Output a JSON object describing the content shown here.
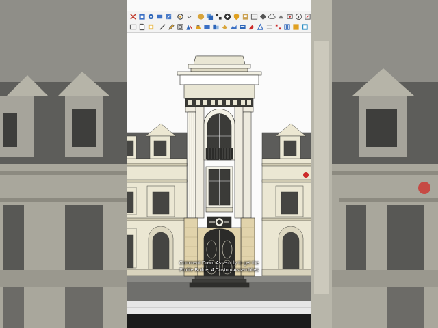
{
  "caption": {
    "line1": "Comment Down Assembly to get the",
    "line2": "Profile Builder 4 Custom Assemblies"
  },
  "toolbar": {
    "row1_icons": [
      "close-icon",
      "select-icon",
      "tape-icon",
      "component-icon",
      "paint-icon",
      "orbit-icon",
      "dropdown-icon",
      "solid-icon",
      "outliner-icon",
      "group-icon",
      "plus-icon",
      "shield-icon",
      "layers-icon",
      "scene-icon",
      "network-icon",
      "cloud-icon",
      "push-icon",
      "extension-icon",
      "info-icon",
      "dynamic-icon",
      "cart-icon",
      "power-icon"
    ],
    "row2_icons": [
      "rectangle-icon",
      "page-icon",
      "layout-icon",
      "line-icon",
      "pencil-icon",
      "offset-icon",
      "move-icon",
      "stamp-icon",
      "follow-icon",
      "section-icon",
      "rotate-icon",
      "sandbox-icon",
      "scale-icon",
      "eraser-icon",
      "flip-icon",
      "align-icon",
      "array-icon",
      "profile-icon",
      "assembly-icon",
      "material-icon",
      "render-icon"
    ]
  },
  "colors": {
    "accent": "#cc2a2a",
    "toolbar_bg": "#f3f3f3",
    "facade": "#e8e5d2",
    "roof": "#6b6b6b"
  }
}
